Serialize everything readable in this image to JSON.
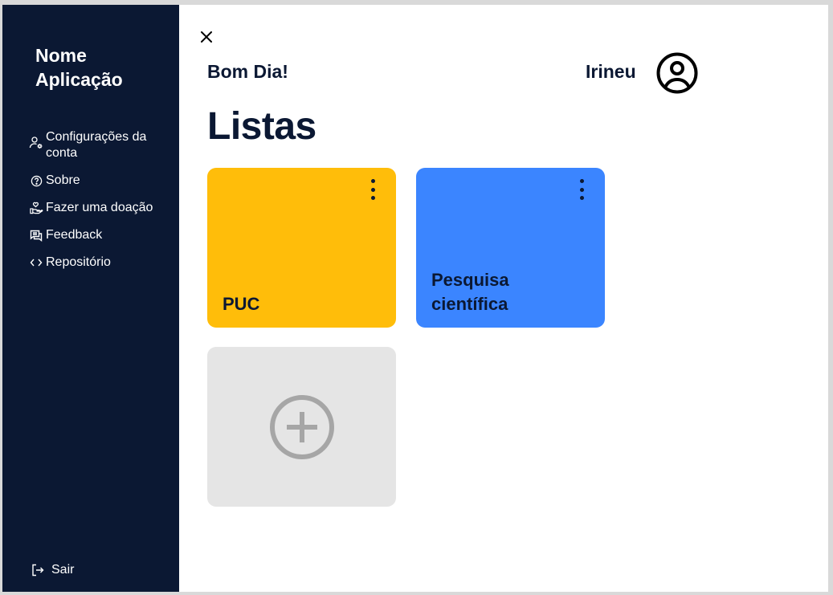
{
  "app": {
    "name": "Nome Aplicação"
  },
  "sidebar": {
    "items": [
      {
        "label": "Configurações da conta",
        "icon": "user-gear-icon"
      },
      {
        "label": "Sobre",
        "icon": "help-circle-icon"
      },
      {
        "label": "Fazer uma doação",
        "icon": "hand-heart-icon"
      },
      {
        "label": "Feedback",
        "icon": "chat-icon"
      },
      {
        "label": "Repositório",
        "icon": "code-icon"
      }
    ],
    "logout": {
      "label": "Sair",
      "icon": "logout-icon"
    }
  },
  "header": {
    "greeting": "Bom Dia!",
    "username": "Irineu"
  },
  "main": {
    "title": "Listas",
    "lists": [
      {
        "name": "PUC",
        "color": "#ffbd0a"
      },
      {
        "name": "Pesquisa científica",
        "color": "#3b85ff"
      }
    ]
  },
  "colors": {
    "sidebar_bg": "#0b1833",
    "text_dark": "#0b1833",
    "add_card_bg": "#e5e5e5",
    "add_icon": "#a6a6a6"
  }
}
